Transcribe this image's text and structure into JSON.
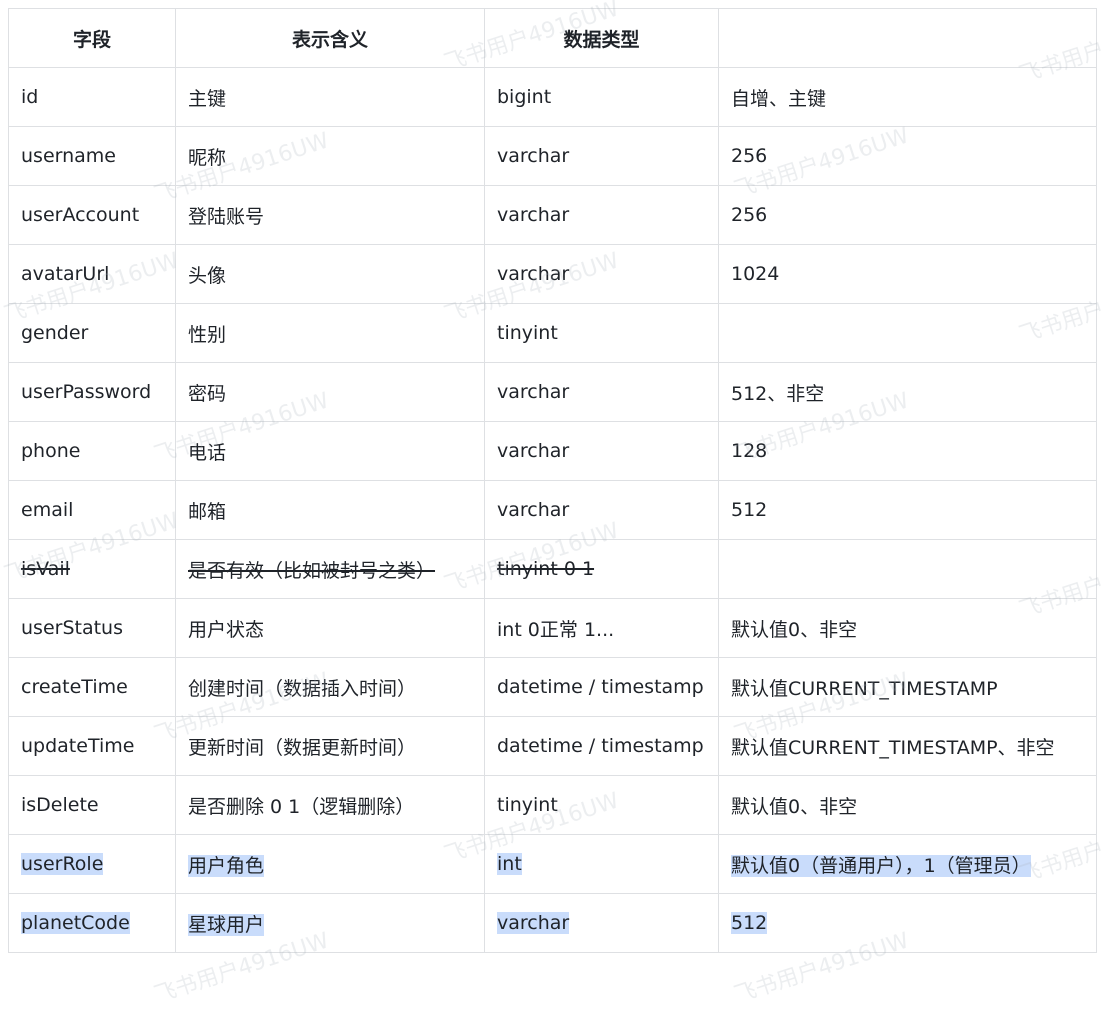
{
  "headers": [
    "字段",
    "表示含义",
    "数据类型",
    ""
  ],
  "rows": [
    {
      "cells": [
        "id",
        "主键",
        "bigint",
        "自增、主键"
      ],
      "style": ""
    },
    {
      "cells": [
        "username",
        "昵称",
        "varchar",
        "256"
      ],
      "style": ""
    },
    {
      "cells": [
        "userAccount",
        "登陆账号",
        "varchar",
        "256"
      ],
      "style": ""
    },
    {
      "cells": [
        "avatarUrl",
        "头像",
        "varchar",
        "1024"
      ],
      "style": ""
    },
    {
      "cells": [
        "gender",
        "性别",
        "tinyint",
        ""
      ],
      "style": ""
    },
    {
      "cells": [
        "userPassword",
        "密码",
        "varchar",
        "512、非空"
      ],
      "style": ""
    },
    {
      "cells": [
        "phone",
        "电话",
        "varchar",
        "128"
      ],
      "style": ""
    },
    {
      "cells": [
        "email",
        "邮箱",
        "varchar",
        "512"
      ],
      "style": ""
    },
    {
      "cells": [
        "isVail",
        "是否有效（比如被封号之类）",
        "tinyint 0 1",
        ""
      ],
      "style": "strike"
    },
    {
      "cells": [
        "userStatus",
        "用户状态",
        "int 0正常 1...",
        "默认值0、非空"
      ],
      "style": ""
    },
    {
      "cells": [
        "createTime",
        "创建时间（数据插入时间）",
        "datetime / timestamp",
        "默认值CURRENT_TIMESTAMP"
      ],
      "style": ""
    },
    {
      "cells": [
        "updateTime",
        "更新时间（数据更新时间）",
        "datetime / timestamp",
        "默认值CURRENT_TIMESTAMP、非空"
      ],
      "style": ""
    },
    {
      "cells": [
        "isDelete",
        "是否删除 0 1（逻辑删除）",
        "tinyint",
        "默认值0、非空"
      ],
      "style": ""
    },
    {
      "cells": [
        "userRole",
        "用户角色",
        "int",
        "默认值0（普通用户），1（管理员）"
      ],
      "style": "sel"
    },
    {
      "cells": [
        "planetCode",
        "星球用户",
        "varchar",
        "512"
      ],
      "style": "sel"
    }
  ],
  "watermark": "飞书用户4916UW"
}
